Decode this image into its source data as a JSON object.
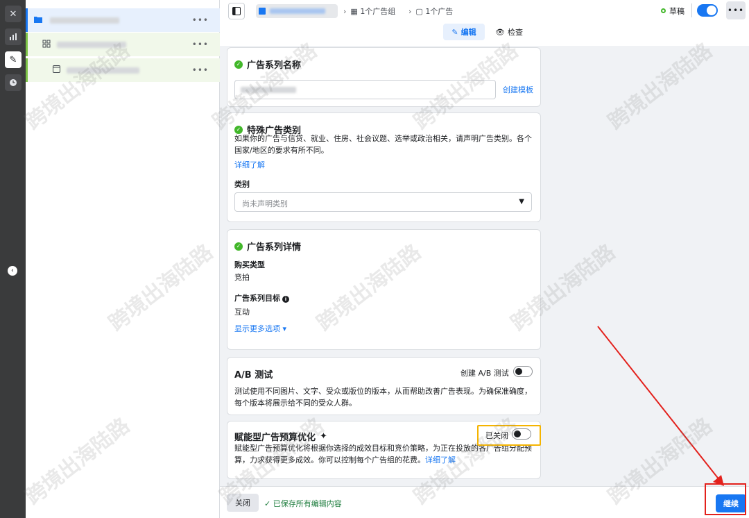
{
  "topbar": {
    "breadcrumb_adset": "1个广告组",
    "breadcrumb_ad": "1个广告",
    "status": "草稿",
    "mode_edit": "编辑",
    "mode_review": "检查"
  },
  "campaign_name_card": {
    "title": "广告系列名称",
    "create_template_link": "创建模板"
  },
  "special_category_card": {
    "title": "特殊广告类别",
    "description": "如果你的广告与信贷、就业、住房、社会议题、选举或政治相关，请声明广告类别。各个国家/地区的要求有所不同。",
    "learn_more": "详细了解",
    "category_label": "类别",
    "category_placeholder": "尚未声明类别"
  },
  "campaign_details_card": {
    "title": "广告系列详情",
    "buy_type_label": "购买类型",
    "buy_type_value": "竞拍",
    "objective_label": "广告系列目标",
    "objective_value": "互动",
    "more_options": "显示更多选项 ▾"
  },
  "ab_test_card": {
    "title": "A/B 测试",
    "toggle_label": "创建 A/B 测试",
    "description": "测试使用不同图片、文字、受众或版位的版本，从而帮助改善广告表现。为确保准确度，每个版本将展示给不同的受众人群。"
  },
  "budget_card": {
    "title": "赋能型广告预算优化",
    "toggle_label": "已关闭",
    "description": "赋能型广告预算优化将根据你选择的成效目标和竞价策略，为正在投放的各广告组分配预算，力求获得更多成效。你可以控制每个广告组的花费。",
    "learn_more": "详细了解"
  },
  "bottombar": {
    "close": "关闭",
    "saved": "✓ 已保存所有编辑内容",
    "continue": "继续"
  },
  "watermark": "跨境出海陆路",
  "colors": {
    "brand": "#1877f2",
    "success": "#42b72a",
    "highlight_red": "#e3211c",
    "highlight_yellow": "#f5b400"
  }
}
